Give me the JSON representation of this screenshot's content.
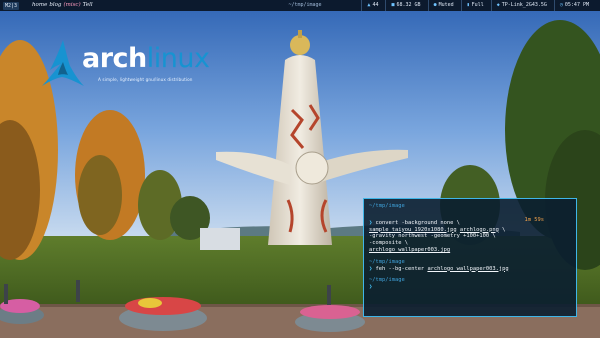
{
  "topbar": {
    "workspace": "M2|3",
    "apps": [
      {
        "label": "home",
        "active": false
      },
      {
        "label": "blog",
        "active": false
      },
      {
        "label": "(misc)",
        "active": true
      },
      {
        "label": "Tell",
        "active": false
      }
    ],
    "window_title": "~/tmp/image",
    "status": [
      {
        "icon": "volume-icon",
        "glyph": "▲",
        "value": "44"
      },
      {
        "icon": "memory-icon",
        "glyph": "■",
        "value": "68.32 GB"
      },
      {
        "icon": "mute-icon",
        "glyph": "●",
        "value": "Muted"
      },
      {
        "icon": "battery-icon",
        "glyph": "▮",
        "value": "Full"
      },
      {
        "icon": "wifi-icon",
        "glyph": "◆",
        "value": "TP-Link_2G43.5G"
      },
      {
        "icon": "clock-icon",
        "glyph": "◷",
        "value": "05:47 PM"
      }
    ]
  },
  "logo": {
    "word_a": "arch",
    "word_b": "linux",
    "tagline": "A simple, lightweight gnu/linux distribution"
  },
  "terminal": {
    "cwd1": "~/tmp/image",
    "elapsed": "1m 59s",
    "prompt": "❯",
    "cmd1_line1": "convert -background none \\",
    "cmd1_file1": "sample_taiyou_1920x1080.jpg",
    "cmd1_file2": "archlogo.png",
    "cmd1_cont": " \\",
    "cmd1_line3": "-gravity northwest -geometry +100+100 \\",
    "cmd1_line4": "-composite \\",
    "cmd1_file3": "archlogo_wallpaper003.jpg",
    "cwd2": "~/tmp/image",
    "cmd2_text": "feh --bg-center ",
    "cmd2_file": "archlogo_wallpaper003.jpg",
    "cwd3": "~/tmp/image"
  },
  "colors": {
    "accent": "#1793d1",
    "terminal_border": "#3fb6e8",
    "bar_bg": "#0c1a2e"
  }
}
